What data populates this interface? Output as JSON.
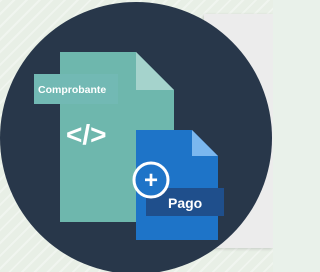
{
  "badge": {
    "circle_color": "#28374a",
    "document_xml": {
      "label": "Comprobante",
      "symbol": "</>",
      "color": "#6eb7ad",
      "label_bg": "#72b9b4",
      "fold_color": "#a5d3cc"
    },
    "document_payment": {
      "label": "Pago",
      "color": "#1e74c8",
      "label_bg": "#1f4f8c",
      "fold_color": "#7bb7ef"
    },
    "plus_symbol": "+",
    "icon_names": [
      "xml-document-icon",
      "code-brackets-icon",
      "payment-document-icon",
      "plus-circle-icon"
    ]
  }
}
